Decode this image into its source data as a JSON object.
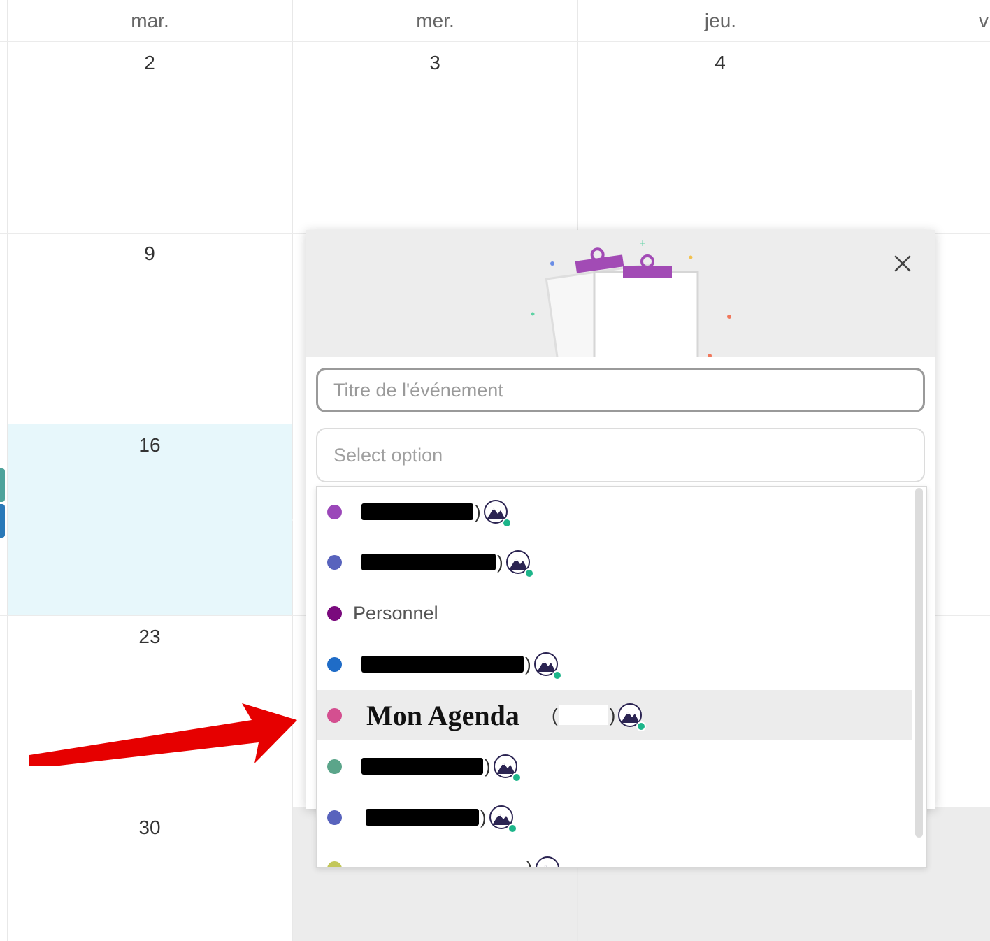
{
  "calendar": {
    "weekdays": [
      "mar.",
      "mer.",
      "jeu.",
      "v"
    ],
    "dates": [
      "2",
      "3",
      "4",
      "9",
      "16",
      "23",
      "30"
    ]
  },
  "modal": {
    "title_placeholder": "Titre de l'événement",
    "select_placeholder": "Select option",
    "close_icon": "close-icon"
  },
  "dropdown": {
    "items": [
      {
        "label": "",
        "color": "#9b47b9"
      },
      {
        "label": "",
        "color": "#5863bd"
      },
      {
        "label": "Personnel",
        "color": "#7a0a7d"
      },
      {
        "label": "",
        "color": "#1f6cc7"
      },
      {
        "label": "Mon Agenda",
        "color": "#d44f90",
        "selected": true
      },
      {
        "label": "",
        "color": "#5ba58a"
      },
      {
        "label": "",
        "color": "#5863bd"
      },
      {
        "label": "",
        "color": "#c3c75a"
      }
    ]
  },
  "colors": {
    "today_bg": "#e7f7fb",
    "accent_purple": "#a24bb5",
    "online_green": "#1db58a",
    "annotation_red": "#e60000"
  }
}
